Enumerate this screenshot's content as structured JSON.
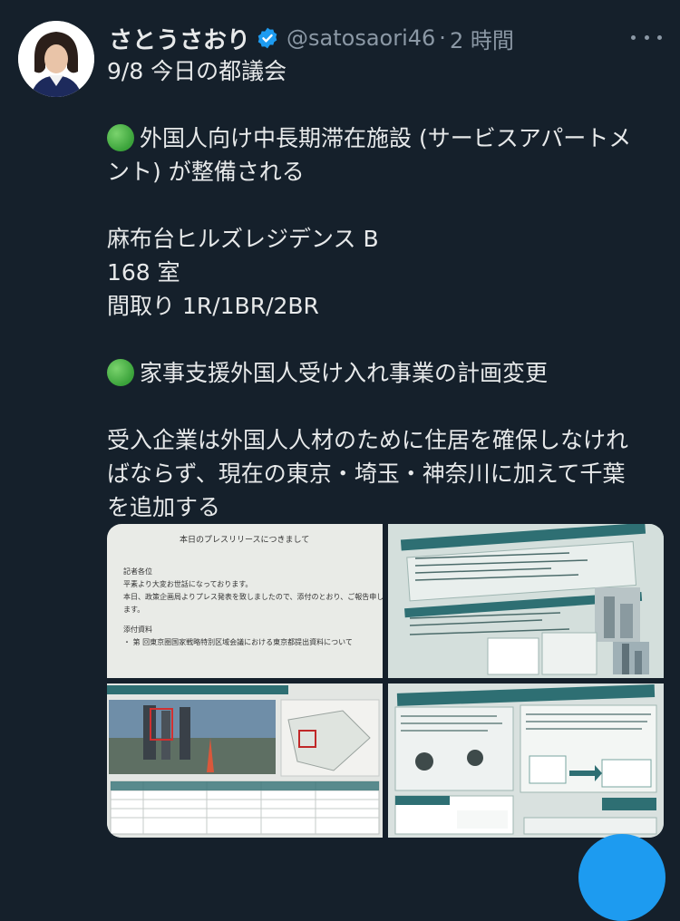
{
  "author": {
    "display_name": "さとうさおり",
    "handle": "@satosaori46",
    "separator": "·",
    "time": "2 時間",
    "verified_icon": "verified-badge-icon",
    "more_icon": "more-options-icon"
  },
  "tweet": {
    "lines": [
      "9/8 今日の都議会",
      "",
      "外国人向け中長期滞在施設 (サービスアパートメ",
      "ント) が整備される",
      "",
      "麻布台ヒルズレジデンス B",
      "168 室",
      "間取り 1R/1BR/2BR",
      "",
      "家事支援外国人受け入れ事業の計画変更",
      "",
      "受入企業は外国人人材のために住居を確保しなけれ",
      "ばならず、現在の東京・埼玉・神奈川に加えて千葉",
      "を追加する"
    ],
    "bullet_icon": "green-circle-icon"
  },
  "media": {
    "photo1": {
      "title": "本日のプレスリリースにつきまして",
      "body": [
        "記者各位",
        "平素より大変お世話になっております。",
        "本日、政策企画局よりプレス発表を致しましたので、添付のとおり、ご報告申し上げ",
        "ます。"
      ],
      "attach_label": "添付資料",
      "attach_item": "・ 第 回東京圏国家戦略特別区域会議における東京都提出資料について"
    }
  },
  "colors": {
    "background": "#15202b",
    "text": "#e7e9ea",
    "muted": "#8b98a5",
    "accent": "#1d9bf0",
    "green": "#3aa23a"
  }
}
